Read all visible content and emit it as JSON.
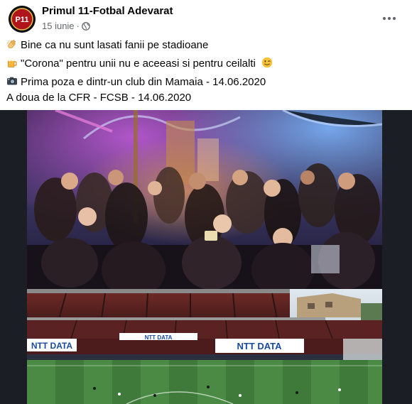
{
  "post": {
    "page_name": "Primul 11-Fotbal Adevarat",
    "avatar_text": "P11",
    "date": "15 iunie",
    "separator": "·",
    "privacy_icon": "globe-icon",
    "more_icon": "more-options-icon",
    "more_label": "•••",
    "lines": [
      {
        "icon": "clapping-hands-icon",
        "text": "Bine ca nu sunt lasati fanii pe stadioane"
      },
      {
        "icon": "beer-mug-icon",
        "text": "\"Corona\" pentru unii nu e aceeasi si pentru ceilalti",
        "trailing_icon": "winking-face-icon"
      },
      {
        "icon": "camera-icon",
        "text": "Prima poza e dintr-un club din Mamaia - 14.06.2020"
      },
      {
        "text": "A doua de la CFR - FCSB - 14.06.2020"
      }
    ],
    "photos": [
      {
        "name": "club-photo"
      },
      {
        "name": "stadium-photo",
        "signs": [
          "NTT DATA",
          "NTT DATA",
          "NTT DATA"
        ]
      }
    ]
  }
}
